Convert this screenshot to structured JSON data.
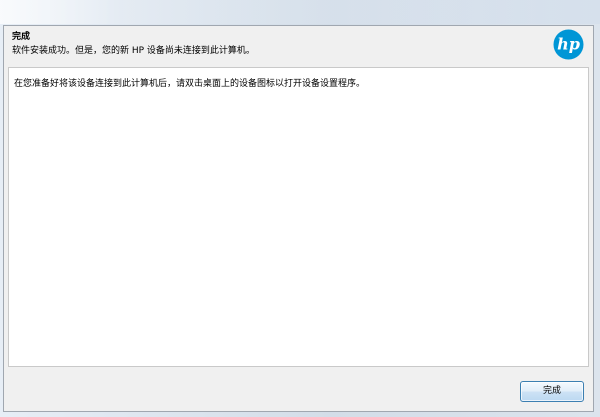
{
  "header": {
    "title": "完成",
    "subtitle": "软件安装成功。但是，您的新 HP 设备尚未连接到此计算机。",
    "logo_text": "hp"
  },
  "content": {
    "message": "在您准备好将该设备连接到此计算机后，请双击桌面上的设备图标以打开设备设置程序。"
  },
  "footer": {
    "finish_label": "完成"
  },
  "colors": {
    "logo_blue": "#0096d6",
    "button_border": "#3c7fb1"
  }
}
